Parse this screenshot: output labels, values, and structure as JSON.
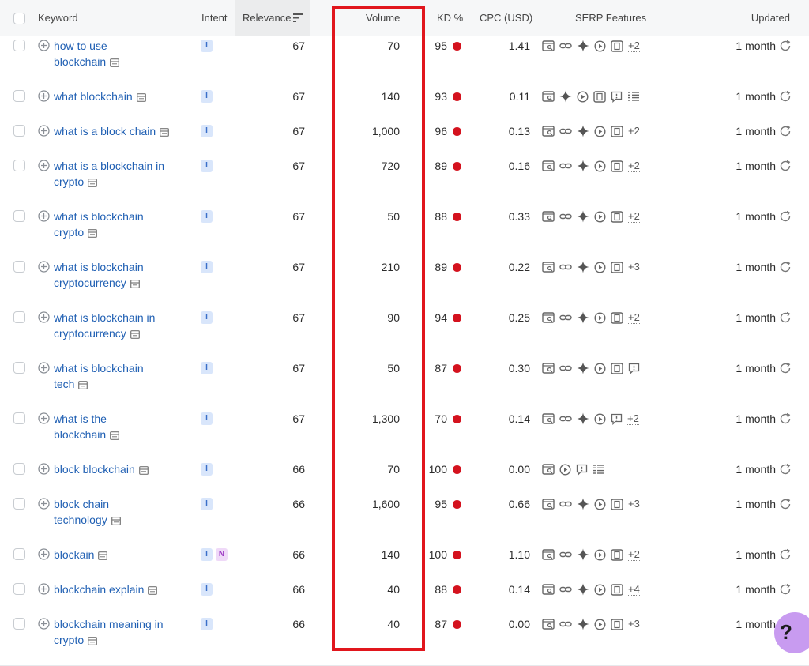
{
  "header": {
    "keyword": "Keyword",
    "intent": "Intent",
    "relevance": "Relevance",
    "volume": "Volume",
    "kd": "KD %",
    "cpc": "CPC (USD)",
    "serp": "SERP Features",
    "updated": "Updated"
  },
  "rows": [
    {
      "kw1": "how to use",
      "kw2": "blockchain",
      "intent": [
        "I"
      ],
      "relevance": "67",
      "volume": "70",
      "kd": "95",
      "cpc": "1.41",
      "serp": [
        "snippet",
        "link",
        "ai",
        "video",
        "reel"
      ],
      "more": "+2",
      "updated": "1 month",
      "tall": true
    },
    {
      "kw1": "what blockchain",
      "kw2": "",
      "intent": [
        "I"
      ],
      "relevance": "67",
      "volume": "140",
      "kd": "93",
      "cpc": "0.11",
      "serp": [
        "snippet",
        "ai",
        "video",
        "reel",
        "faq",
        "list"
      ],
      "more": "",
      "updated": "1 month",
      "tall": false
    },
    {
      "kw1": "what is a block chain",
      "kw2": "",
      "intent": [
        "I"
      ],
      "relevance": "67",
      "volume": "1,000",
      "kd": "96",
      "cpc": "0.13",
      "serp": [
        "snippet",
        "link",
        "ai",
        "video",
        "reel"
      ],
      "more": "+2",
      "updated": "1 month",
      "tall": false
    },
    {
      "kw1": "what is a blockchain in",
      "kw2": "crypto",
      "intent": [
        "I"
      ],
      "relevance": "67",
      "volume": "720",
      "kd": "89",
      "cpc": "0.16",
      "serp": [
        "snippet",
        "link",
        "ai",
        "video",
        "reel"
      ],
      "more": "+2",
      "updated": "1 month",
      "tall": true
    },
    {
      "kw1": "what is blockchain",
      "kw2": "crypto",
      "intent": [
        "I"
      ],
      "relevance": "67",
      "volume": "50",
      "kd": "88",
      "cpc": "0.33",
      "serp": [
        "snippet",
        "link",
        "ai",
        "video",
        "reel"
      ],
      "more": "+2",
      "updated": "1 month",
      "tall": true
    },
    {
      "kw1": "what is blockchain",
      "kw2": "cryptocurrency",
      "intent": [
        "I"
      ],
      "relevance": "67",
      "volume": "210",
      "kd": "89",
      "cpc": "0.22",
      "serp": [
        "snippet",
        "link",
        "ai",
        "video",
        "reel"
      ],
      "more": "+3",
      "updated": "1 month",
      "tall": true
    },
    {
      "kw1": "what is blockchain in",
      "kw2": "cryptocurrency",
      "intent": [
        "I"
      ],
      "relevance": "67",
      "volume": "90",
      "kd": "94",
      "cpc": "0.25",
      "serp": [
        "snippet",
        "link",
        "ai",
        "video",
        "reel"
      ],
      "more": "+2",
      "updated": "1 month",
      "tall": true
    },
    {
      "kw1": "what is blockchain",
      "kw2": "tech",
      "intent": [
        "I"
      ],
      "relevance": "67",
      "volume": "50",
      "kd": "87",
      "cpc": "0.30",
      "serp": [
        "snippet",
        "link",
        "ai",
        "video",
        "reel",
        "faq"
      ],
      "more": "",
      "updated": "1 month",
      "tall": true
    },
    {
      "kw1": "what is the",
      "kw2": "blockchain",
      "intent": [
        "I"
      ],
      "relevance": "67",
      "volume": "1,300",
      "kd": "70",
      "cpc": "0.14",
      "serp": [
        "snippet",
        "link",
        "ai",
        "video",
        "faq"
      ],
      "more": "+2",
      "updated": "1 month",
      "tall": true
    },
    {
      "kw1": "block blockchain",
      "kw2": "",
      "intent": [
        "I"
      ],
      "relevance": "66",
      "volume": "70",
      "kd": "100",
      "cpc": "0.00",
      "serp": [
        "snippet",
        "video",
        "faq",
        "list"
      ],
      "more": "",
      "updated": "1 month",
      "tall": false
    },
    {
      "kw1": "block chain",
      "kw2": "technology",
      "intent": [
        "I"
      ],
      "relevance": "66",
      "volume": "1,600",
      "kd": "95",
      "cpc": "0.66",
      "serp": [
        "snippet",
        "link",
        "ai",
        "video",
        "reel"
      ],
      "more": "+3",
      "updated": "1 month",
      "tall": true
    },
    {
      "kw1": "blockain",
      "kw2": "",
      "intent": [
        "I",
        "N"
      ],
      "relevance": "66",
      "volume": "140",
      "kd": "100",
      "cpc": "1.10",
      "serp": [
        "snippet",
        "link",
        "ai",
        "video",
        "reel"
      ],
      "more": "+2",
      "updated": "1 month",
      "tall": false
    },
    {
      "kw1": "blockchain explain",
      "kw2": "",
      "intent": [
        "I"
      ],
      "relevance": "66",
      "volume": "40",
      "kd": "88",
      "cpc": "0.14",
      "serp": [
        "snippet",
        "link",
        "ai",
        "video",
        "reel"
      ],
      "more": "+4",
      "updated": "1 month",
      "tall": false
    },
    {
      "kw1": "blockchain meaning in",
      "kw2": "crypto",
      "intent": [
        "I"
      ],
      "relevance": "66",
      "volume": "40",
      "kd": "87",
      "cpc": "0.00",
      "serp": [
        "snippet",
        "link",
        "ai",
        "video",
        "reel"
      ],
      "more": "+3",
      "updated": "1 month",
      "tall": true
    }
  ],
  "help": {
    "label": "?"
  },
  "colors": {
    "accent": "#1f5fb3",
    "kd_dot": "#d4121e",
    "highlight": "#e1161d"
  }
}
